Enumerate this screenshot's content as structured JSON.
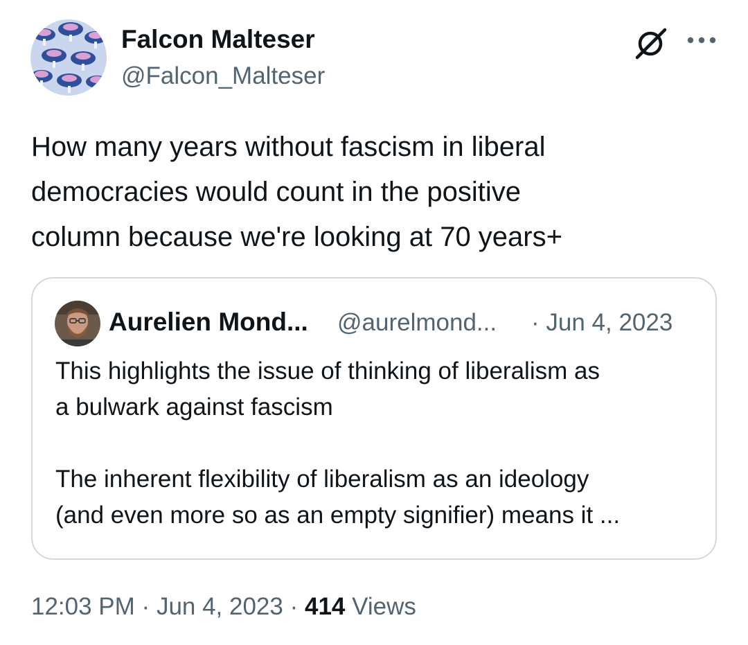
{
  "author": {
    "display_name": "Falcon Malteser",
    "handle": "@Falcon_Malteser",
    "avatar_icon": "mushroom-pattern-avatar"
  },
  "header_actions": {
    "grok_icon": "grok-icon",
    "more_icon": "more-options-icon"
  },
  "tweet": {
    "text_lines": [
      "How many years without fascism in liberal",
      "democracies would count in the positive",
      "column because we're looking at 70 years+"
    ]
  },
  "quote": {
    "display_name": "Aurelien Mond...",
    "handle": "@aurelmond...",
    "date": "· Jun 4, 2023",
    "avatar_icon": "bearded-man-avatar",
    "paragraph1": [
      "This highlights the issue of thinking of liberalism as",
      "a bulwark against fascism"
    ],
    "paragraph2": [
      "The inherent flexibility of liberalism as an ideology",
      "(and even more so as an empty signifier) means it ..."
    ]
  },
  "meta": {
    "time": "12:03 PM",
    "sep1": "·",
    "date": "Jun 4, 2023",
    "sep2": "·",
    "views_count": "414",
    "views_label": "Views"
  },
  "colors": {
    "text_primary": "#0f1419",
    "text_secondary": "#536471",
    "border": "#cfd9de"
  }
}
